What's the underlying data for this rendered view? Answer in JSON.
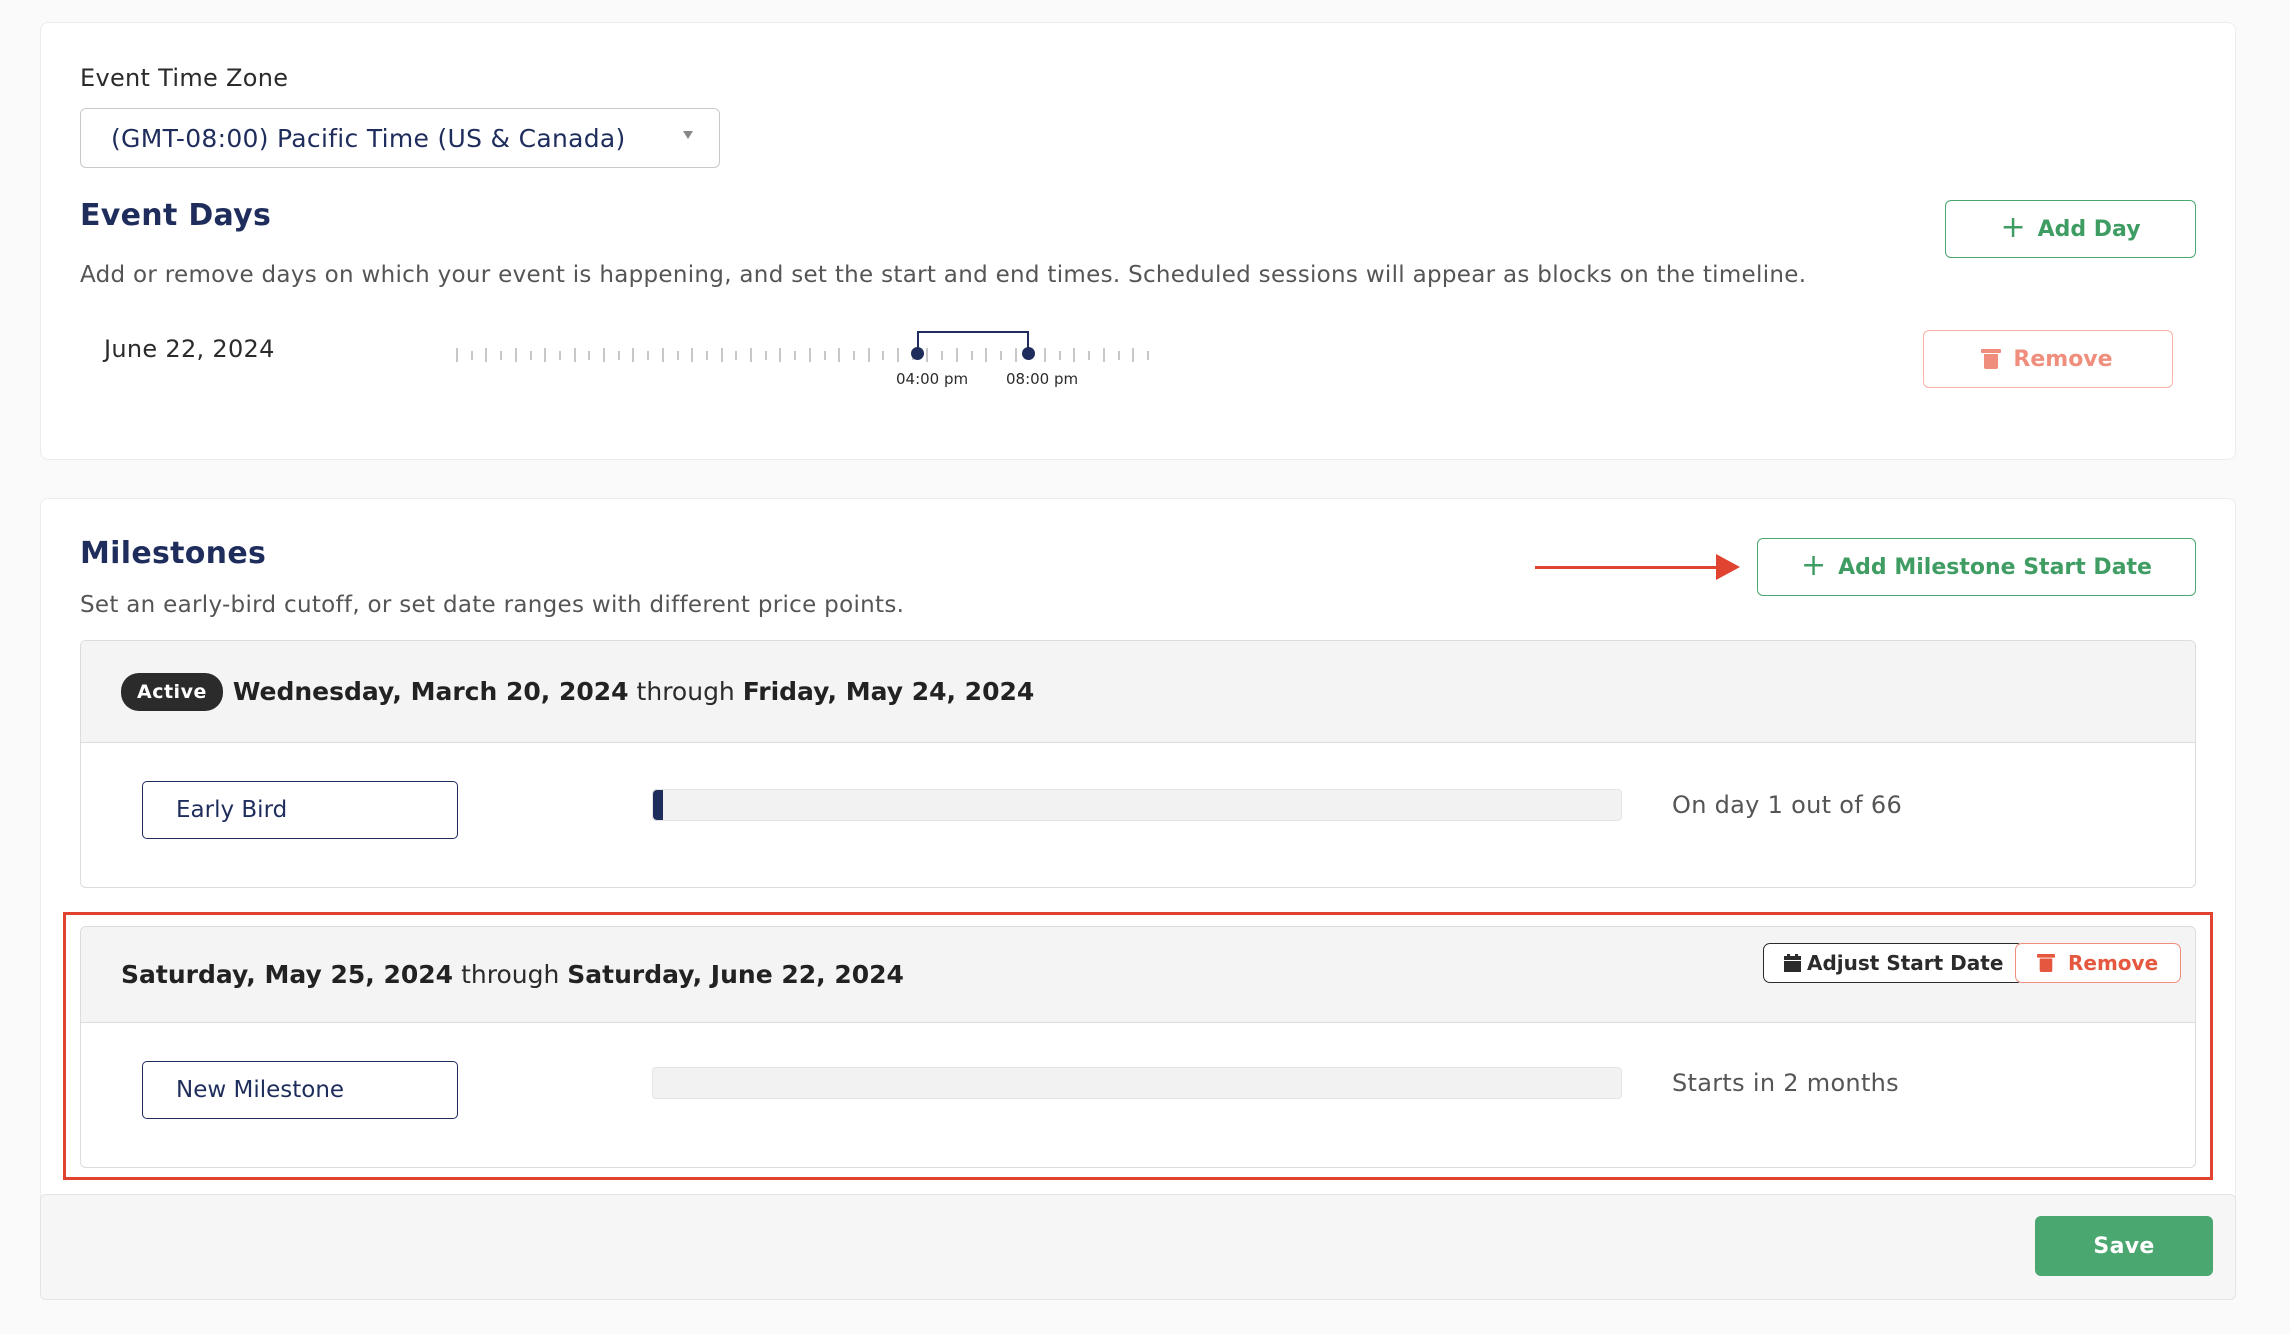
{
  "event_days": {
    "timezone_label": "Event Time Zone",
    "timezone_value": "(GMT-08:00) Pacific Time (US & Canada)",
    "title": "Event Days",
    "description": "Add or remove days on which your event is happening, and set the start and end times. Scheduled sessions will appear as blocks on the timeline.",
    "add_day_label": "Add Day",
    "days": [
      {
        "date": "June 22, 2024",
        "start_label": "04:00 pm",
        "end_label": "08:00 pm",
        "remove_label": "Remove"
      }
    ]
  },
  "milestones": {
    "title": "Milestones",
    "description": "Set an early-bird cutoff, or set date ranges with different price points.",
    "add_label": "Add Milestone Start Date",
    "items": [
      {
        "badge": "Active",
        "start": "Wednesday, March 20, 2024",
        "through": "through",
        "end": "Friday, May 24, 2024",
        "name": "Early Bird",
        "progress": 0.01,
        "status": "On day 1 out of 66"
      },
      {
        "start": "Saturday, May 25, 2024",
        "through": "through",
        "end": "Saturday, June 22, 2024",
        "name": "New Milestone",
        "progress": 0,
        "status": "Starts in 2 months",
        "adjust_label": "Adjust Start Date",
        "remove_label": "Remove"
      }
    ]
  },
  "footer": {
    "save_label": "Save"
  },
  "colors": {
    "navy": "#1f2d5c",
    "green": "#4aa76f",
    "remove_red": "#e5583f",
    "annotation_red": "#e0432f"
  },
  "icons": {
    "dropdown": "caret-down-icon",
    "add": "plus-icon",
    "remove": "trash-icon",
    "adjust": "calendar-icon",
    "annotation": "arrow-right-icon"
  }
}
